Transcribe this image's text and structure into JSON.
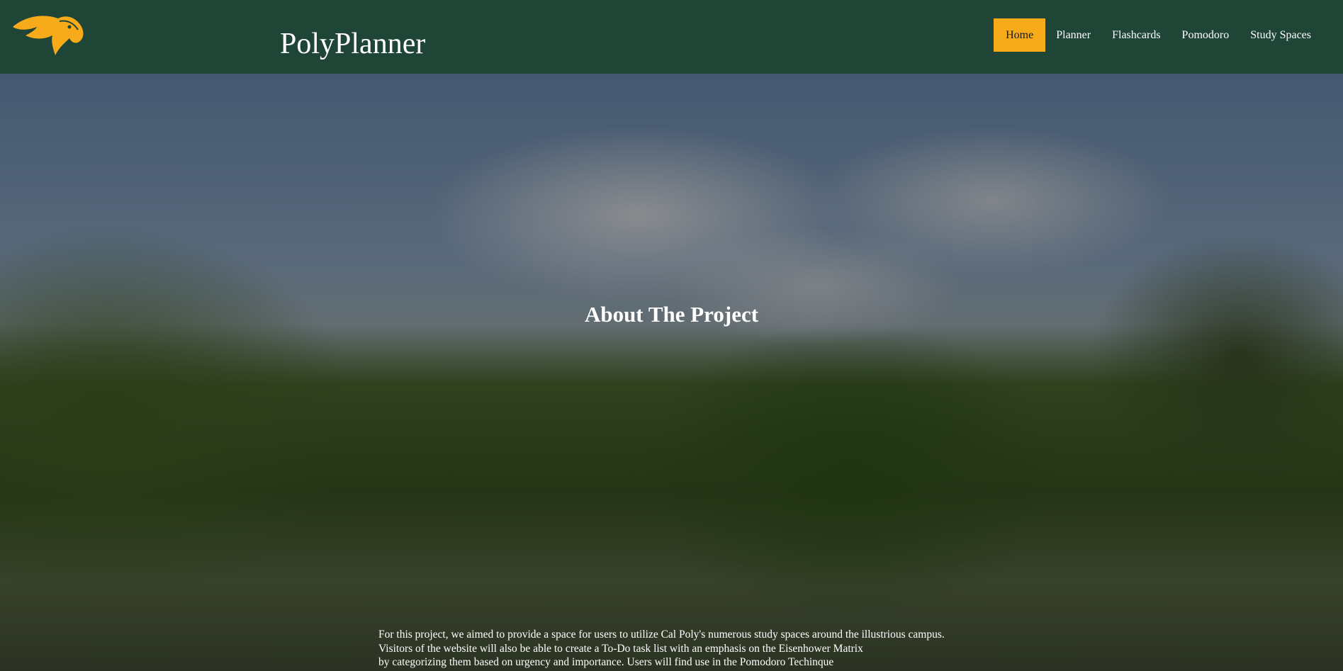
{
  "header": {
    "title": "PolyPlanner",
    "logo_icon": "mustang-horse-logo",
    "colors": {
      "background": "#1e4535",
      "accent": "#f7ab1a"
    },
    "nav": [
      {
        "label": "Home",
        "active": true
      },
      {
        "label": "Planner",
        "active": false
      },
      {
        "label": "Flashcards",
        "active": false
      },
      {
        "label": "Pomodoro",
        "active": false
      },
      {
        "label": "Study Spaces",
        "active": false
      }
    ]
  },
  "hero": {
    "heading": "About The Project",
    "paragraph_lines": [
      "For this project, we aimed to provide a space for users to utilize Cal Poly's numerous study spaces around the illustrious campus.",
      "Visitors of the website will also be able to create a To-Do task list with an emphasis on the Eisenhower Matrix",
      "by categorizing them based on urgency and importance. Users will find use in the Pomodoro Techinque"
    ]
  }
}
